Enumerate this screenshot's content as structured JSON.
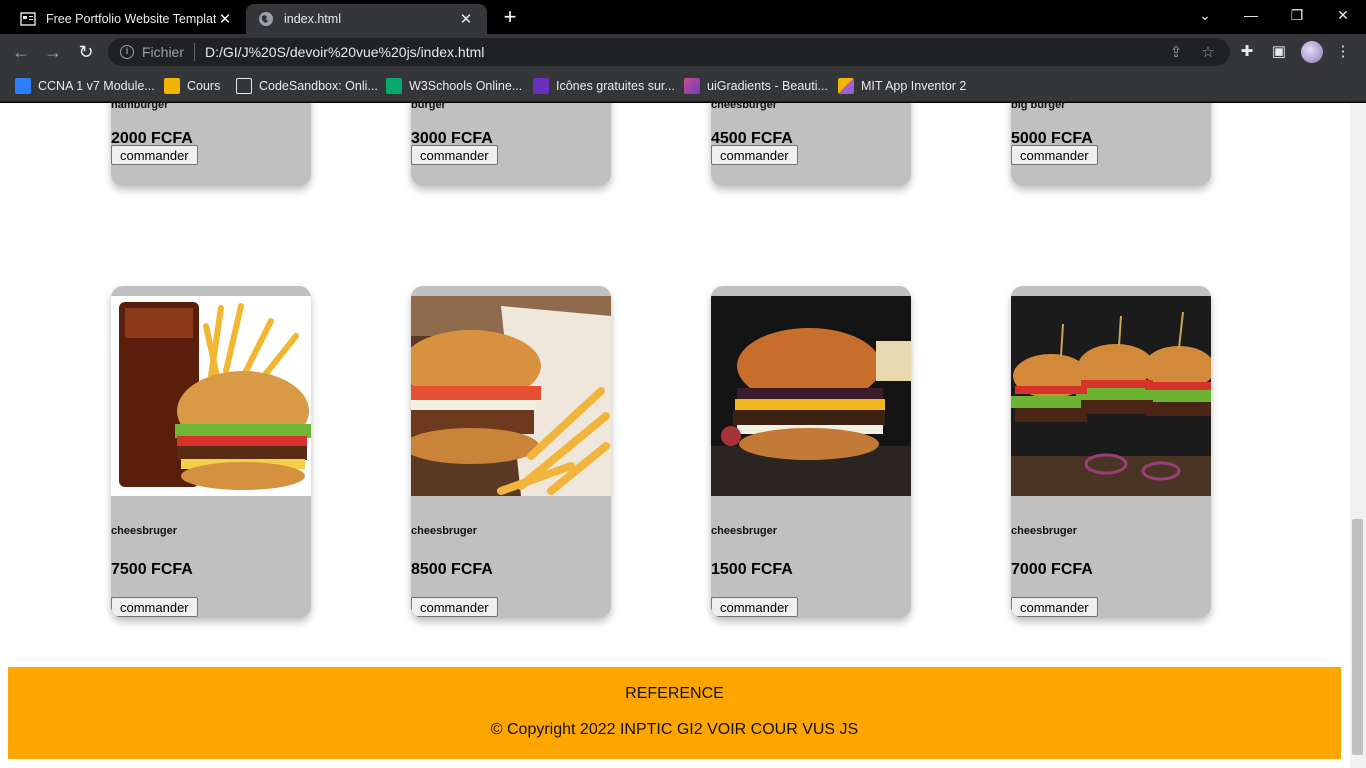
{
  "browser": {
    "tabs": [
      {
        "title": "Free Portfolio Website Templates"
      },
      {
        "title": "index.html"
      }
    ],
    "address": {
      "scheme": "Fichier",
      "url": "D:/GI/J%20S/devoir%20vue%20js/index.html"
    },
    "bookmarks": [
      {
        "label": "CCNA 1 v7 Module...",
        "color": "#2d7ff9"
      },
      {
        "label": "Cours",
        "color": "#f4b400"
      },
      {
        "label": "CodeSandbox: Onli...",
        "color": "#ffffff"
      },
      {
        "label": "W3Schools Online...",
        "color": "#04aa6d"
      },
      {
        "label": "Icônes gratuites sur...",
        "color": "#6b2fbf"
      },
      {
        "label": "uiGradients - Beauti...",
        "color": "#c94b8b"
      },
      {
        "label": "MIT App Inventor 2",
        "color": "#a05fd0"
      }
    ]
  },
  "page": {
    "top_row": [
      {
        "name": "hamburger",
        "price": "2000 FCFA",
        "button": "commander"
      },
      {
        "name": "burger",
        "price": "3000 FCFA",
        "button": "commander"
      },
      {
        "name": "cheesburger",
        "price": "4500 FCFA",
        "button": "commander"
      },
      {
        "name": "big burger",
        "price": "5000 FCFA",
        "button": "commander"
      }
    ],
    "bottom_row": [
      {
        "name": "cheesbruger",
        "price": "7500 FCFA",
        "button": "commander"
      },
      {
        "name": "cheesbruger",
        "price": "8500 FCFA",
        "button": "commander"
      },
      {
        "name": "cheesbruger",
        "price": "1500 FCFA",
        "button": "commander"
      },
      {
        "name": "cheesbruger",
        "price": "7000 FCFA",
        "button": "commander"
      }
    ],
    "footer": {
      "reference": "REFERENCE",
      "copyright": "© Copyright 2022 INPTIC GI2 VOIR COUR VUS JS"
    }
  },
  "colors": {
    "footer": "#ffa500",
    "card": "#c0c0c0"
  }
}
